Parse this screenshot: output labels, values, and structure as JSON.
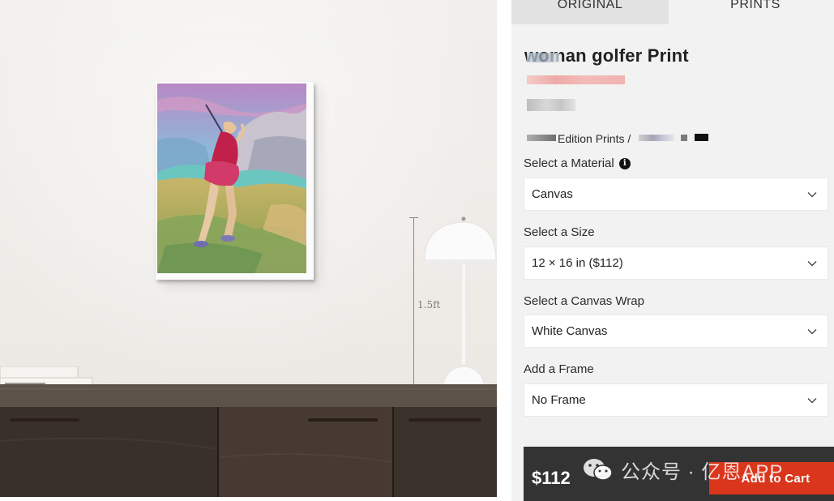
{
  "tabs": [
    {
      "label": "ORIGINAL",
      "active": false
    },
    {
      "label": "PRINTS",
      "active": true
    }
  ],
  "product": {
    "title": "woman golfer Print",
    "edition_text": "Edition Prints /"
  },
  "scene": {
    "measure_label": "1.5ft"
  },
  "options": {
    "material": {
      "label": "Select a Material",
      "value": "Canvas",
      "info_icon": "info-circle-icon"
    },
    "size": {
      "label": "Select a Size",
      "value": "12 × 16 in ($112)"
    },
    "wrap": {
      "label": "Select a Canvas Wrap",
      "value": "White Canvas"
    },
    "frame": {
      "label": "Add a Frame",
      "value": "No Frame"
    }
  },
  "cart": {
    "price": "$112",
    "button_label": "Add to Cart"
  },
  "watermark": {
    "text": "公众号 · 亿恩APP",
    "icon": "wechat-icon"
  },
  "colors": {
    "panel_bg": "#f2f2f2",
    "cart_bar": "#333333",
    "cart_button": "#d9361c"
  }
}
